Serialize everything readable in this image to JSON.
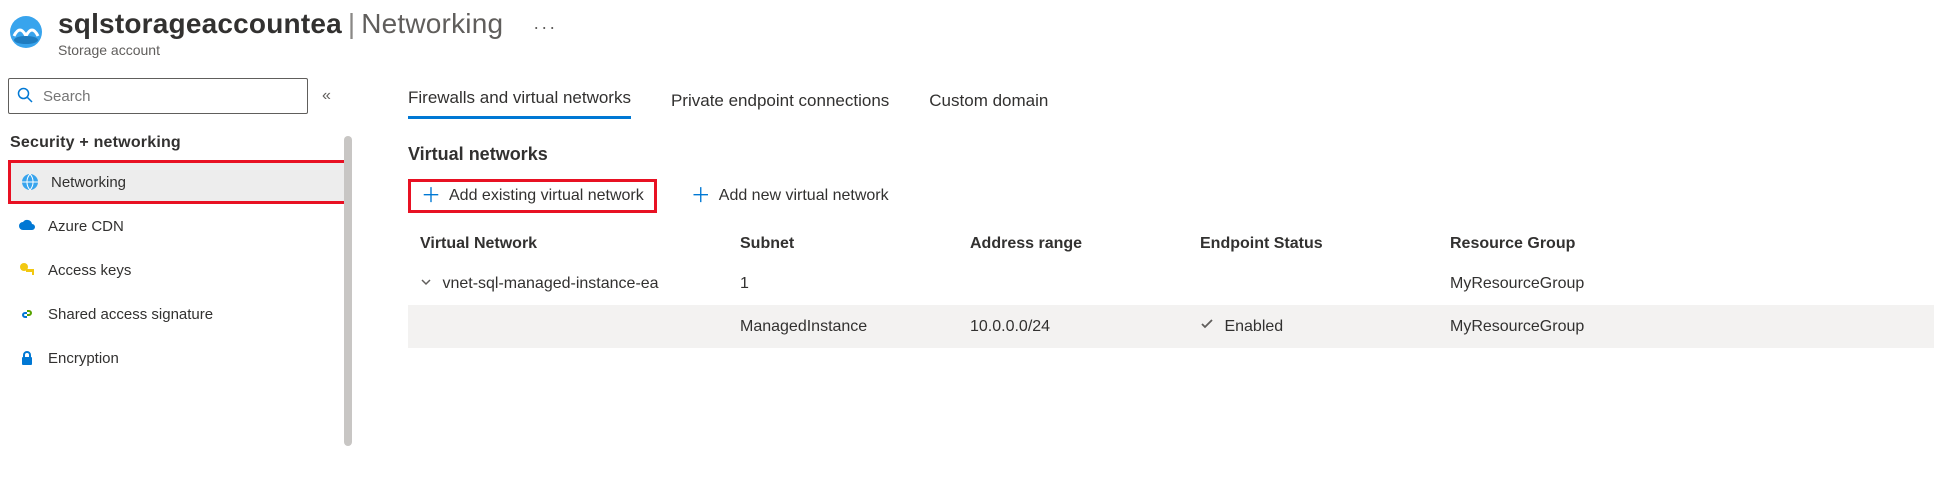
{
  "header": {
    "resource_name": "sqlstorageaccountea",
    "page_name": "Networking",
    "resource_type": "Storage account",
    "more": "···"
  },
  "sidebar": {
    "search_placeholder": "Search",
    "group": "Security + networking",
    "items": [
      {
        "label": "Networking",
        "selected": true
      },
      {
        "label": "Azure CDN",
        "selected": false
      },
      {
        "label": "Access keys",
        "selected": false
      },
      {
        "label": "Shared access signature",
        "selected": false
      },
      {
        "label": "Encryption",
        "selected": false
      }
    ]
  },
  "tabs": [
    {
      "label": "Firewalls and virtual networks",
      "active": true
    },
    {
      "label": "Private endpoint connections",
      "active": false
    },
    {
      "label": "Custom domain",
      "active": false
    }
  ],
  "section_title": "Virtual networks",
  "actions": {
    "add_existing": "Add existing virtual network",
    "add_new": "Add new virtual network"
  },
  "table": {
    "columns": [
      "Virtual Network",
      "Subnet",
      "Address range",
      "Endpoint Status",
      "Resource Group"
    ],
    "rows": [
      {
        "vnet": "vnet-sql-managed-instance-ea",
        "subnet": "1",
        "address_range": "",
        "endpoint_status": "",
        "resource_group": "MyResourceGroup",
        "expandable": true
      },
      {
        "vnet": "",
        "subnet": "ManagedInstance",
        "address_range": "10.0.0.0/24",
        "endpoint_status": "Enabled",
        "resource_group": "MyResourceGroup",
        "subrow": true
      }
    ]
  }
}
